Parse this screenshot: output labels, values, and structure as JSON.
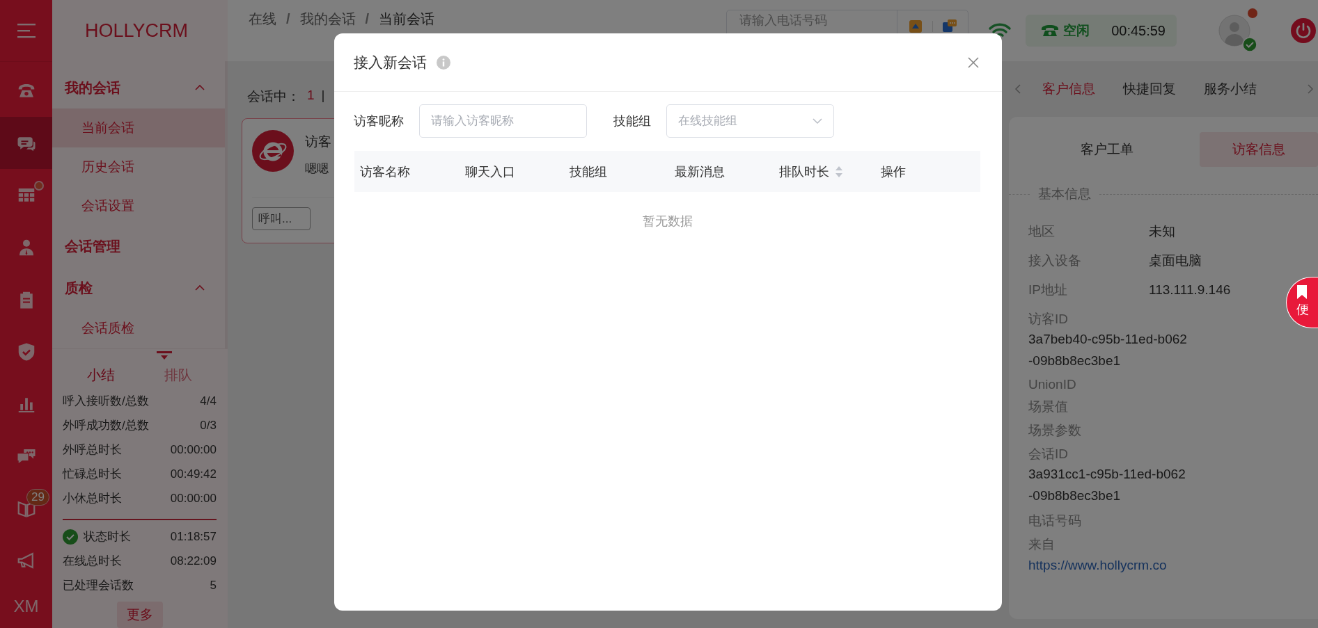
{
  "rail": {
    "items": [
      {
        "kind": "phone",
        "selected": false,
        "dot": false
      },
      {
        "kind": "chat",
        "selected": true,
        "dot": false
      },
      {
        "kind": "grid",
        "selected": false,
        "dot": true
      },
      {
        "kind": "person",
        "selected": false,
        "dot": false
      },
      {
        "kind": "clipboard",
        "selected": false,
        "dot": false
      },
      {
        "kind": "shield",
        "selected": false,
        "dot": false
      },
      {
        "kind": "chart",
        "selected": false,
        "dot": false
      },
      {
        "kind": "messages",
        "selected": false,
        "dot": false
      },
      {
        "kind": "book",
        "selected": false,
        "dot": false,
        "badge": "29"
      },
      {
        "kind": "megaphone",
        "selected": false,
        "dot": false
      },
      {
        "kind": "text",
        "label": "XM",
        "selected": false,
        "dot": false
      }
    ]
  },
  "header": {
    "logo": "HOLLYCRM",
    "breadcrumb": [
      {
        "kind": "link",
        "text": "在线"
      },
      {
        "kind": "separator",
        "text": "/"
      },
      {
        "kind": "link",
        "text": "我的会话"
      },
      {
        "kind": "separator",
        "text": "/"
      },
      {
        "kind": "current",
        "text": "当前会话"
      }
    ],
    "phone_search": {
      "placeholder": "请输入电话号码"
    },
    "status": {
      "label": "空闲",
      "timer": "00:45:59"
    },
    "avatar": {
      "online": true,
      "notification": true
    }
  },
  "menu": {
    "groups": [
      {
        "title": "我的会话",
        "expanded": true,
        "items": [
          {
            "label": "当前会话",
            "selected": true
          },
          {
            "label": "历史会话",
            "selected": false
          },
          {
            "label": "会话设置",
            "selected": false
          }
        ]
      },
      {
        "title": "会话管理"
      },
      {
        "title": "质检",
        "expanded": true,
        "items": [
          {
            "label": "会话质检",
            "selected": false
          }
        ]
      }
    ]
  },
  "summary": {
    "tabs": [
      {
        "label": "小结",
        "selected": true
      },
      {
        "label": "排队",
        "selected": false
      }
    ],
    "stats": [
      {
        "label": "呼入接听数/总数",
        "value": "4/4"
      },
      {
        "label": "外呼成功数/总数",
        "value": "0/3"
      },
      {
        "label": "外呼总时长",
        "value": "00:00:00"
      },
      {
        "label": "忙碌总时长",
        "value": "00:49:42"
      },
      {
        "label": "小休总时长",
        "value": "00:00:00"
      }
    ],
    "status_stats": [
      {
        "kind": "status",
        "label": "状态时长",
        "value": "01:18:57"
      },
      {
        "kind": "plain",
        "label": "在线总时长",
        "value": "08:22:09"
      },
      {
        "kind": "plain",
        "label": "已处理会话数",
        "value": "5"
      }
    ],
    "more_button": "更多"
  },
  "session_pane": {
    "status_label": "会话中：",
    "active_count": "1",
    "separator": "|",
    "card": {
      "title": "访客",
      "preview": "嗯嗯",
      "buttons": [
        "呼叫..."
      ]
    }
  },
  "info_panel": {
    "tabs": [
      {
        "label": "客户信息",
        "selected": true
      },
      {
        "label": "快捷回复",
        "selected": false
      },
      {
        "label": "服务小结",
        "selected": false
      }
    ],
    "sub_tabs": [
      {
        "label": "客户工单",
        "selected": false
      },
      {
        "label": "访客信息",
        "selected": true
      }
    ],
    "section_title": "基本信息",
    "fields": [
      {
        "kind": "inline",
        "label": "地区",
        "value": "未知"
      },
      {
        "kind": "inline",
        "label": "接入设备",
        "value": "桌面电脑"
      },
      {
        "kind": "inline",
        "label": "IP地址",
        "value": "113.111.9.146"
      },
      {
        "kind": "stacked",
        "label": "访客ID",
        "value": "3a7beb40-c95b-11ed-b062-09b8b8ec3be1"
      },
      {
        "kind": "stacked",
        "label": "UnionID"
      },
      {
        "kind": "stacked",
        "label": "场景值"
      },
      {
        "kind": "stacked",
        "label": "场景参数"
      },
      {
        "kind": "stacked",
        "label": "会话ID",
        "value": "3a931cc1-c95b-11ed-b062-09b8b8ec3be1"
      },
      {
        "kind": "stacked",
        "label": "电话号码"
      },
      {
        "kind": "link",
        "label": "来自",
        "value": "https://www.hollycrm.co"
      }
    ]
  },
  "sticky_note": {
    "label": "便"
  },
  "dialog": {
    "title": "接入新会话",
    "fields": [
      {
        "kind": "input",
        "label": "访客昵称",
        "placeholder": "请输入访客昵称"
      },
      {
        "kind": "select",
        "label": "技能组",
        "placeholder": "在线技能组"
      }
    ],
    "table": {
      "columns": [
        {
          "label": "访客名称",
          "sortable": false
        },
        {
          "label": "聊天入口",
          "sortable": false
        },
        {
          "label": "技能组",
          "sortable": false
        },
        {
          "label": "最新消息",
          "sortable": false
        },
        {
          "label": "排队时长",
          "sortable": true
        },
        {
          "label": "操作",
          "sortable": false
        }
      ],
      "empty_text": "暂无数据"
    }
  }
}
